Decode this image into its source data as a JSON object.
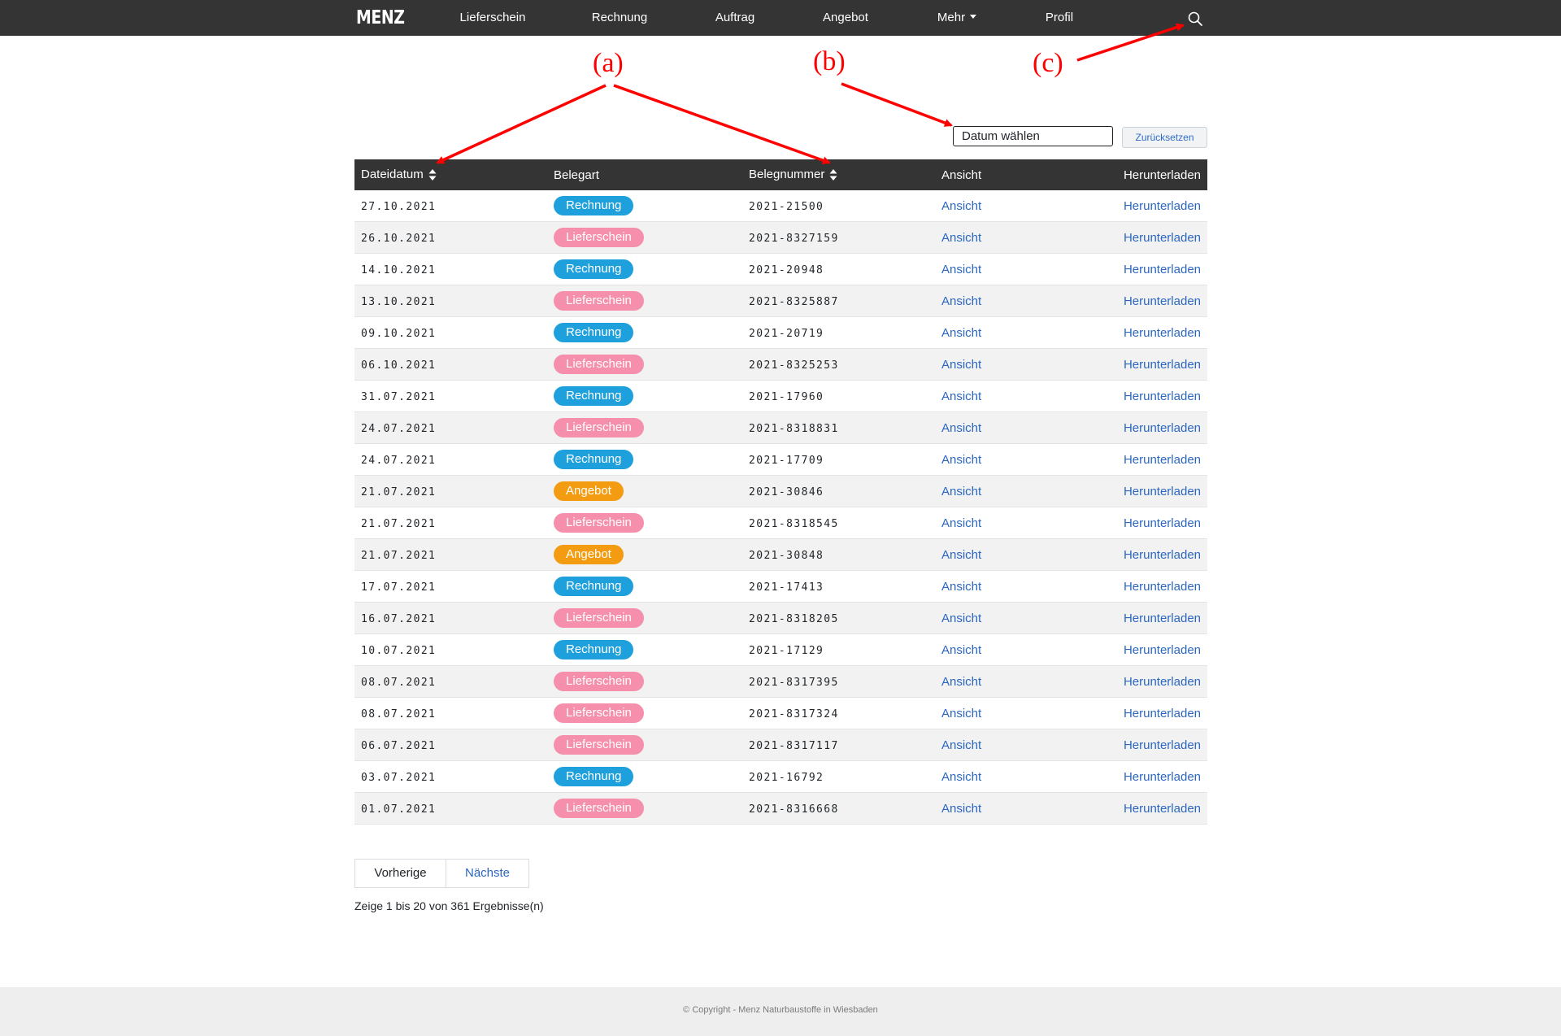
{
  "nav": {
    "brand": "MENZ",
    "items": [
      {
        "label": "Lieferschein"
      },
      {
        "label": "Rechnung"
      },
      {
        "label": "Auftrag"
      },
      {
        "label": "Angebot"
      },
      {
        "label": "Mehr"
      },
      {
        "label": "Profil"
      }
    ],
    "search_icon": "search-icon"
  },
  "annotations": {
    "a": "(a)",
    "b": "(b)",
    "c": "(c)",
    "color": "#ff0000"
  },
  "filter": {
    "date_placeholder": "Datum wählen",
    "reset_label": "Zurücksetzen"
  },
  "table": {
    "headers": [
      "Dateidatum",
      "Belegart",
      "Belegnummer",
      "Ansicht",
      "Herunterladen"
    ],
    "rows": [
      {
        "date": "27.10.2021",
        "type": "Rechnung",
        "number": "2021-21500",
        "view": "Ansicht",
        "download": "Herunterladen"
      },
      {
        "date": "26.10.2021",
        "type": "Lieferschein",
        "number": "2021-8327159",
        "view": "Ansicht",
        "download": "Herunterladen"
      },
      {
        "date": "14.10.2021",
        "type": "Rechnung",
        "number": "2021-20948",
        "view": "Ansicht",
        "download": "Herunterladen"
      },
      {
        "date": "13.10.2021",
        "type": "Lieferschein",
        "number": "2021-8325887",
        "view": "Ansicht",
        "download": "Herunterladen"
      },
      {
        "date": "09.10.2021",
        "type": "Rechnung",
        "number": "2021-20719",
        "view": "Ansicht",
        "download": "Herunterladen"
      },
      {
        "date": "06.10.2021",
        "type": "Lieferschein",
        "number": "2021-8325253",
        "view": "Ansicht",
        "download": "Herunterladen"
      },
      {
        "date": "31.07.2021",
        "type": "Rechnung",
        "number": "2021-17960",
        "view": "Ansicht",
        "download": "Herunterladen"
      },
      {
        "date": "24.07.2021",
        "type": "Lieferschein",
        "number": "2021-8318831",
        "view": "Ansicht",
        "download": "Herunterladen"
      },
      {
        "date": "24.07.2021",
        "type": "Rechnung",
        "number": "2021-17709",
        "view": "Ansicht",
        "download": "Herunterladen"
      },
      {
        "date": "21.07.2021",
        "type": "Angebot",
        "number": "2021-30846",
        "view": "Ansicht",
        "download": "Herunterladen"
      },
      {
        "date": "21.07.2021",
        "type": "Lieferschein",
        "number": "2021-8318545",
        "view": "Ansicht",
        "download": "Herunterladen"
      },
      {
        "date": "21.07.2021",
        "type": "Angebot",
        "number": "2021-30848",
        "view": "Ansicht",
        "download": "Herunterladen"
      },
      {
        "date": "17.07.2021",
        "type": "Rechnung",
        "number": "2021-17413",
        "view": "Ansicht",
        "download": "Herunterladen"
      },
      {
        "date": "16.07.2021",
        "type": "Lieferschein",
        "number": "2021-8318205",
        "view": "Ansicht",
        "download": "Herunterladen"
      },
      {
        "date": "10.07.2021",
        "type": "Rechnung",
        "number": "2021-17129",
        "view": "Ansicht",
        "download": "Herunterladen"
      },
      {
        "date": "08.07.2021",
        "type": "Lieferschein",
        "number": "2021-8317395",
        "view": "Ansicht",
        "download": "Herunterladen"
      },
      {
        "date": "08.07.2021",
        "type": "Lieferschein",
        "number": "2021-8317324",
        "view": "Ansicht",
        "download": "Herunterladen"
      },
      {
        "date": "06.07.2021",
        "type": "Lieferschein",
        "number": "2021-8317117",
        "view": "Ansicht",
        "download": "Herunterladen"
      },
      {
        "date": "03.07.2021",
        "type": "Rechnung",
        "number": "2021-16792",
        "view": "Ansicht",
        "download": "Herunterladen"
      },
      {
        "date": "01.07.2021",
        "type": "Lieferschein",
        "number": "2021-8316668",
        "view": "Ansicht",
        "download": "Herunterladen"
      }
    ],
    "badge_colors": {
      "Rechnung": "#1ea0dd",
      "Lieferschein": "#f58fab",
      "Angebot": "#f39c12"
    }
  },
  "pagination": {
    "prev_label": "Vorherige",
    "next_label": "Nächste",
    "info": "Zeige 1 bis 20 von 361 Ergebnisse(n)"
  },
  "footer": {
    "text": "© Copyright - Menz Naturbaustoffe in Wiesbaden"
  }
}
